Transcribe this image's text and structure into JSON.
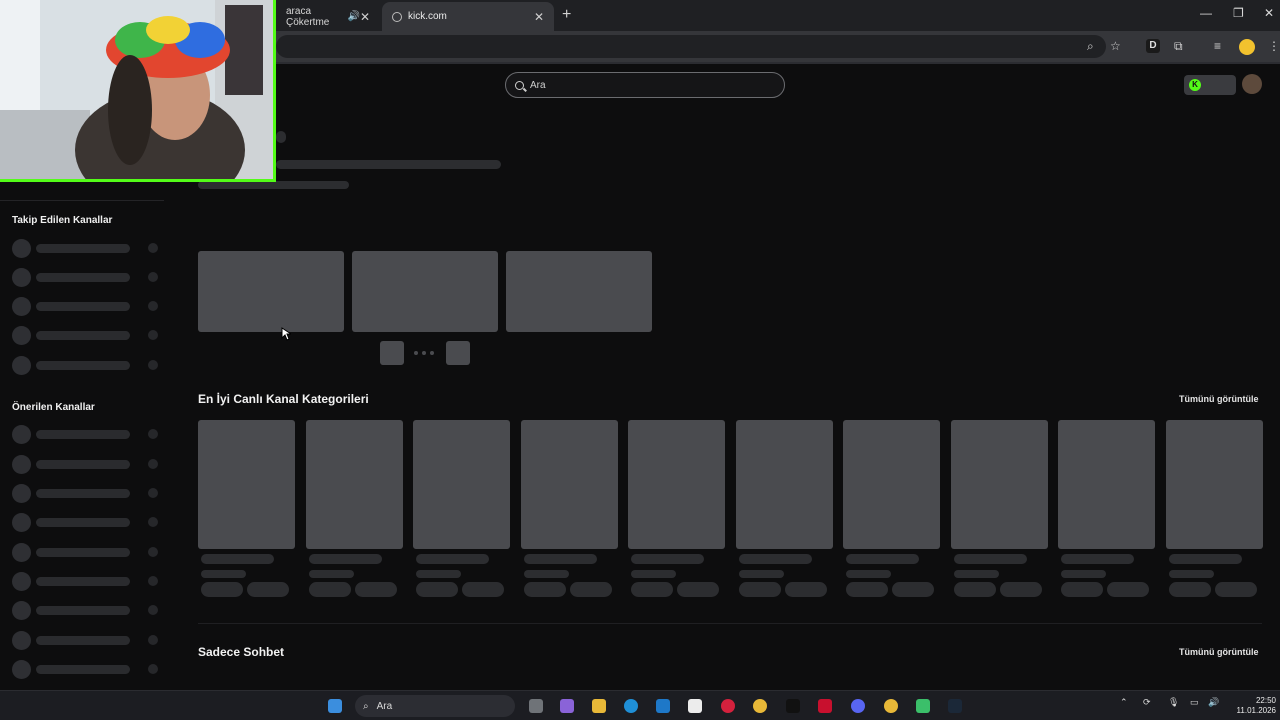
{
  "browser": {
    "tabs": [
      {
        "label": "araca Çökertme",
        "active": false
      },
      {
        "label": "kick.com",
        "active": true
      }
    ],
    "new_tab": "+",
    "window_controls": {
      "minimize": "—",
      "maximize": "❐",
      "close": "✕"
    }
  },
  "page": {
    "search_placeholder": "Ara",
    "sidebar": {
      "followed_title": "Takip Edilen Kanallar",
      "recommended_title": "Önerilen Kanallar"
    },
    "sections": {
      "top_categories": "En İyi Canlı Kanal Kategorileri",
      "chat_only": "Sadece Sohbet",
      "view_all": "Tümünü görüntüle"
    }
  },
  "taskbar": {
    "search_label": "Ara",
    "time": "22:50",
    "date": "11.01.2026"
  },
  "colors": {
    "kick_green": "#53fc18",
    "skeleton": "#4a4b4f",
    "background": "#0d0d0e"
  }
}
